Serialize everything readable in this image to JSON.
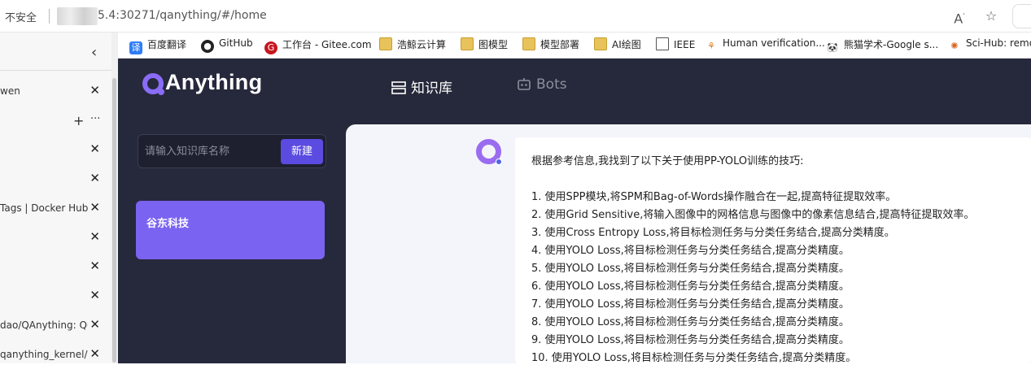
{
  "browser": {
    "insecure_label": "不安全",
    "url": "5.4:30271/qanything/#/home",
    "vertical_tabs": [
      {
        "title": "wen"
      },
      {
        "title": ""
      },
      {
        "title": ""
      },
      {
        "title": "Tags | Docker Hub"
      },
      {
        "title": ""
      },
      {
        "title": ""
      },
      {
        "title": ""
      },
      {
        "title": "dao/QAnything: Qu"
      },
      {
        "title": "qanything_kernel/qa"
      }
    ],
    "bookmarks": [
      {
        "label": "百度翻译",
        "icon": "baidu-translate-icon"
      },
      {
        "label": "GitHub",
        "icon": "github-icon"
      },
      {
        "label": "工作台 - Gitee.com",
        "icon": "gitee-icon"
      },
      {
        "label": "浩鲸云计算",
        "icon": "folder-icon"
      },
      {
        "label": "图模型",
        "icon": "folder-icon"
      },
      {
        "label": "模型部署",
        "icon": "folder-icon"
      },
      {
        "label": "AI绘图",
        "icon": "folder-icon"
      },
      {
        "label": "IEEE",
        "icon": "document-icon"
      },
      {
        "label": "Human verification...",
        "icon": "verification-icon"
      },
      {
        "label": "熊猫学术-Google s...",
        "icon": "panda-icon"
      },
      {
        "label": "Sci-Hub: remov",
        "icon": "scihub-icon"
      }
    ]
  },
  "app": {
    "logo_text": "Anything",
    "nav": {
      "knowledge_base": "知识库",
      "bots": "Bots"
    },
    "kb_search_placeholder": "请输入知识库名称",
    "new_button": "新建",
    "kb_items": [
      {
        "name": "谷东科技"
      }
    ],
    "colors": {
      "accent": "#7b63f2",
      "button": "#5b4be0",
      "dark_bg": "#26293b"
    }
  },
  "chat": {
    "message_lines": [
      "根据参考信息,我找到了以下关于使用PP-YOLO训练的技巧:",
      "",
      "1. 使用SPP模块,将SPM和Bag-of-Words操作融合在一起,提高特征提取效率。",
      "2. 使用Grid Sensitive,将输入图像中的网格信息与图像中的像素信息结合,提高特征提取效率。",
      "3. 使用Cross Entropy Loss,将目标检测任务与分类任务结合,提高分类精度。",
      "4. 使用YOLO Loss,将目标检测任务与分类任务结合,提高分类精度。",
      "5. 使用YOLO Loss,将目标检测任务与分类任务结合,提高分类精度。",
      "6. 使用YOLO Loss,将目标检测任务与分类任务结合,提高分类精度。",
      "7. 使用YOLO Loss,将目标检测任务与分类任务结合,提高分类精度。",
      "8. 使用YOLO Loss,将目标检测任务与分类任务结合,提高分类精度。",
      "9. 使用YOLO Loss,将目标检测任务与分类任务结合,提高分类精度。",
      "10. 使用YOLO Loss,将目标检测任务与分类任务结合,提高分类精度。"
    ]
  }
}
